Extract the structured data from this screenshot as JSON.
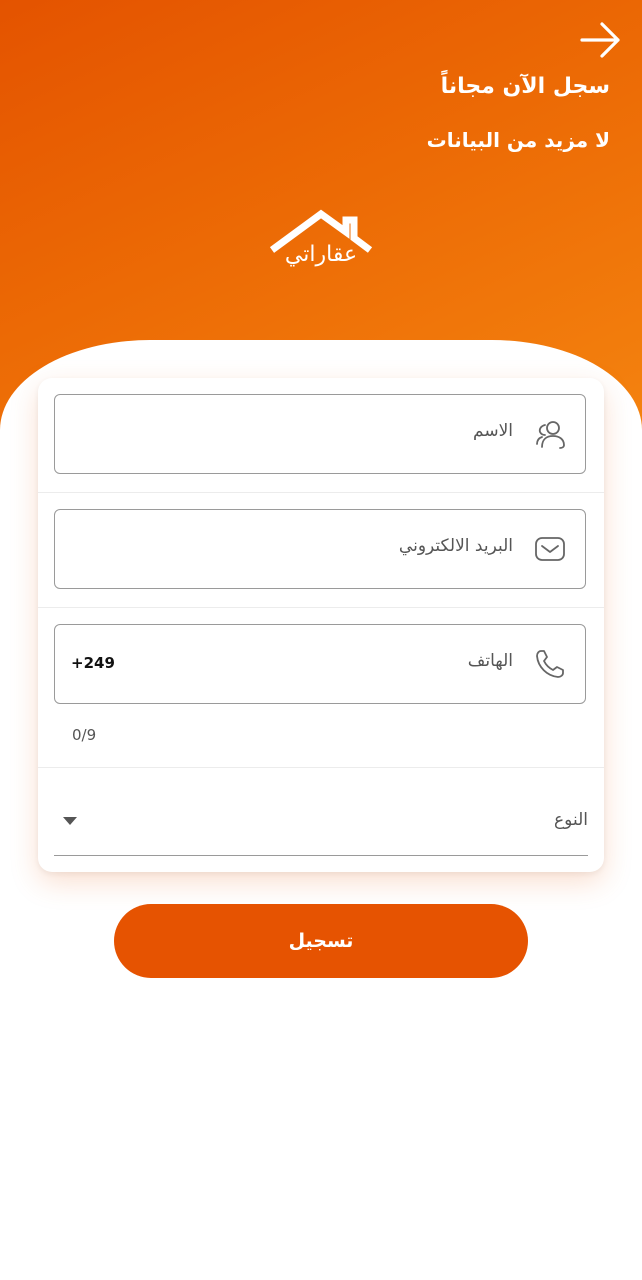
{
  "header": {
    "title": "سجل الآن مجاناً",
    "subtitle": "لا مزيد من البيانات",
    "back_icon": "arrow-right-icon"
  },
  "logo": {
    "text": "عقاراتي",
    "icon": "house-roof-icon"
  },
  "form": {
    "name_field": {
      "placeholder": "الاسم",
      "icon": "users-icon"
    },
    "email_field": {
      "placeholder": "البريد الالكتروني",
      "icon": "mail-icon"
    },
    "phone_field": {
      "placeholder": "الهاتف",
      "prefix": "+249",
      "counter": "0/9",
      "icon": "phone-icon"
    },
    "type_dropdown": {
      "label": "النوع",
      "icon": "caret-down-icon"
    }
  },
  "submit_label": "تسجيل",
  "colors": {
    "primary": "#e65301",
    "gradient_start": "#e45300",
    "gradient_end": "#f58510",
    "field_border": "#9a9a9a"
  }
}
